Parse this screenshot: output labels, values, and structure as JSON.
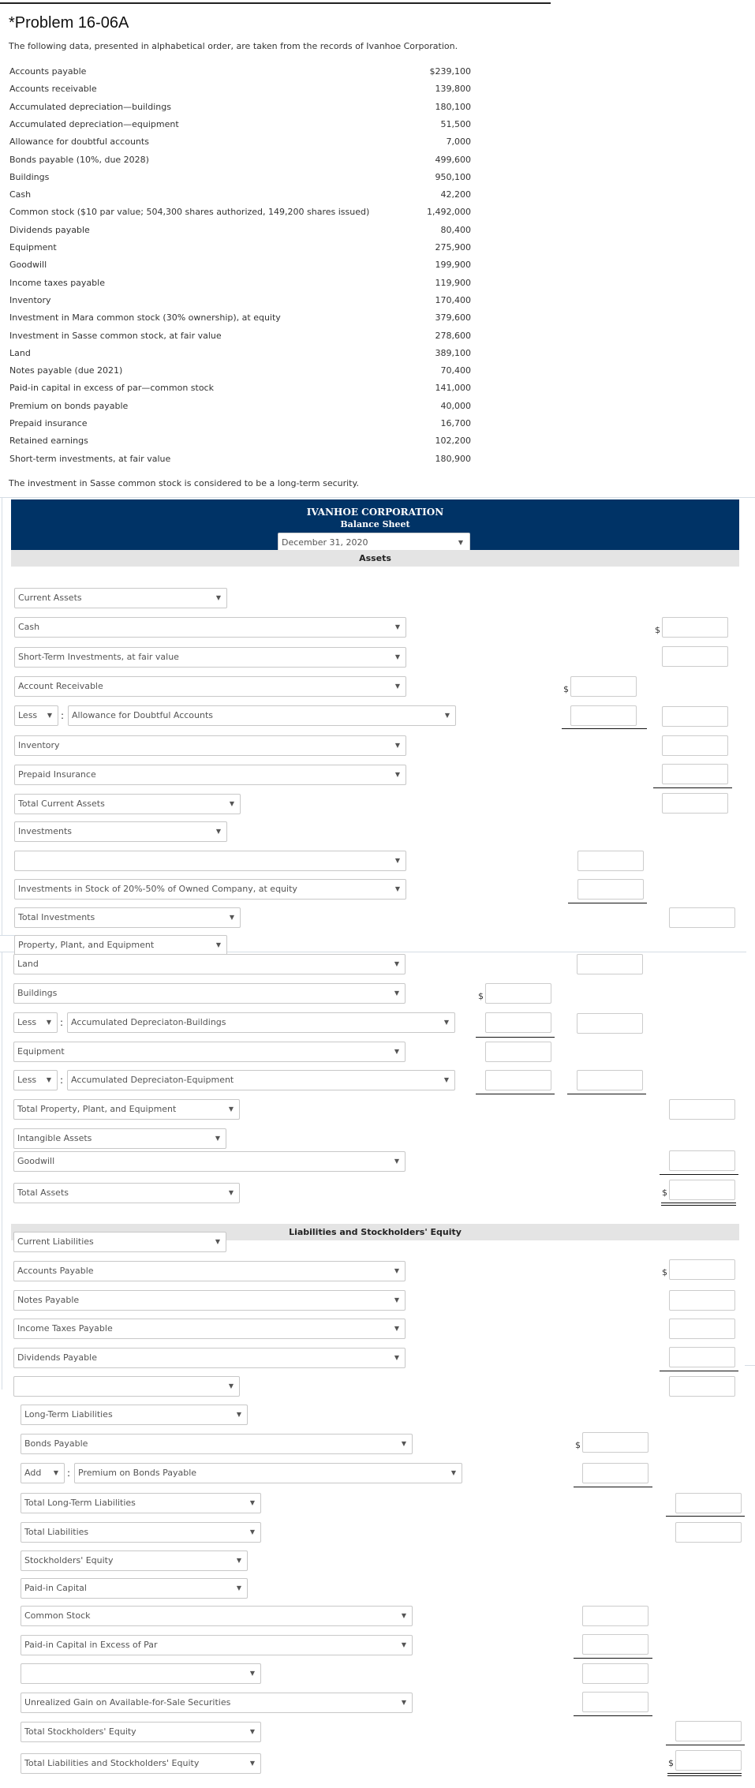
{
  "problem": {
    "title": "*Problem 16-06A",
    "intro": "The following data, presented in alphabetical order, are taken from the records of Ivanhoe Corporation.",
    "accounts": [
      {
        "label": "Accounts payable",
        "value": "$239,100"
      },
      {
        "label": "Accounts receivable",
        "value": "139,800"
      },
      {
        "label": "Accumulated depreciation—buildings",
        "value": "180,100"
      },
      {
        "label": "Accumulated depreciation—equipment",
        "value": "51,500"
      },
      {
        "label": "Allowance for doubtful accounts",
        "value": "7,000"
      },
      {
        "label": "Bonds payable (10%, due 2028)",
        "value": "499,600"
      },
      {
        "label": "Buildings",
        "value": "950,100"
      },
      {
        "label": "Cash",
        "value": "42,200"
      },
      {
        "label": "Common stock ($10 par value; 504,300 shares authorized, 149,200 shares issued)",
        "value": "1,492,000"
      },
      {
        "label": "Dividends payable",
        "value": "80,400"
      },
      {
        "label": "Equipment",
        "value": "275,900"
      },
      {
        "label": "Goodwill",
        "value": "199,900"
      },
      {
        "label": "Income taxes payable",
        "value": "119,900"
      },
      {
        "label": "Inventory",
        "value": "170,400"
      },
      {
        "label": "Investment in Mara common stock (30% ownership), at equity",
        "value": "379,600"
      },
      {
        "label": "Investment in Sasse common stock, at fair value",
        "value": "278,600"
      },
      {
        "label": "Land",
        "value": "389,100"
      },
      {
        "label": "Notes payable (due 2021)",
        "value": "70,400"
      },
      {
        "label": "Paid-in capital in excess of par—common stock",
        "value": "141,000"
      },
      {
        "label": "Premium on bonds payable",
        "value": "40,000"
      },
      {
        "label": "Prepaid insurance",
        "value": "16,700"
      },
      {
        "label": "Retained earnings",
        "value": "102,200"
      },
      {
        "label": "Short-term investments, at fair value",
        "value": "180,900"
      }
    ],
    "note": "The investment in Sasse common stock is considered to be a long-term security."
  },
  "sheet": {
    "company": "IVANHOE CORPORATION",
    "statement": "Balance Sheet",
    "date_selected": "December 31, 2020",
    "assets_header": "Assets",
    "liabilities_header": "Liabilities and Stockholders' Equity",
    "currency_symbol": "$",
    "rows": {
      "current_assets": "Current Assets",
      "cash": "Cash",
      "short_term_investments": "Short-Term Investments, at fair value",
      "accounts_receivable": "Account Receivable",
      "less": "Less",
      "allowance": "Allowance for Doubtful Accounts",
      "inventory": "Inventory",
      "prepaid_insurance": "Prepaid Insurance",
      "total_current_assets": "Total Current Assets",
      "investments": "Investments",
      "investments_blank": "",
      "investment_equity": "Investments in Stock of 20%-50% of Owned Company, at equity",
      "total_investments": "Total Investments",
      "ppe": "Property, Plant, and Equipment",
      "land": "Land",
      "buildings": "Buildings",
      "acc_dep_buildings": "Accumulated Depreciaton-Buildings",
      "equipment": "Equipment",
      "acc_dep_equipment": "Accumulated Depreciaton-Equipment",
      "total_ppe": "Total Property, Plant, and Equipment",
      "intangible_assets": "Intangible Assets",
      "goodwill": "Goodwill",
      "total_assets": "Total Assets",
      "current_liabilities": "Current Liabilities",
      "accounts_payable": "Accounts Payable",
      "notes_payable": "Notes Payable",
      "income_taxes_payable": "Income Taxes Payable",
      "dividends_payable": "Dividends Payable",
      "current_liab_total_blank": "",
      "long_term_liabilities": "Long-Term Liabilities",
      "bonds_payable": "Bonds Payable",
      "add": "Add",
      "premium_on_bonds": "Premium on Bonds Payable",
      "total_long_term_liabilities": "Total Long-Term Liabilities",
      "total_liabilities": "Total Liabilities",
      "stockholders_equity": "Stockholders' Equity",
      "paid_in_capital": "Paid-in Capital",
      "common_stock": "Common Stock",
      "pic_excess": "Paid-in Capital in Excess of Par",
      "equity_blank": "",
      "unrealized_gain": "Unrealized Gain on Available-for-Sale Securities",
      "total_stockholders_equity": "Total Stockholders' Equity",
      "total_liabilities_equity": "Total Liabilities and Stockholders' Equity"
    }
  }
}
